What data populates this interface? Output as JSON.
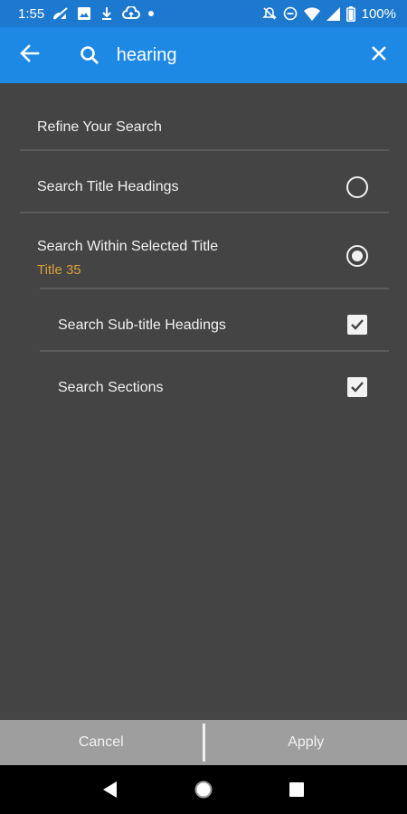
{
  "status": {
    "time": "1:55",
    "battery": "100%",
    "left_icons": [
      "cast-icon",
      "image-icon",
      "download-icon",
      "cloud-upload-icon",
      "dot-icon"
    ],
    "right_icons": [
      "mute-icon",
      "dnd-icon",
      "wifi-icon",
      "signal-icon",
      "battery-icon"
    ]
  },
  "appbar": {
    "search_value": "hearing",
    "back_icon": "arrow-left-icon",
    "search_icon": "search-icon",
    "close_icon": "close-icon"
  },
  "refine": {
    "heading": "Refine Your Search",
    "option_title_headings": {
      "label": "Search Title Headings",
      "selected": false
    },
    "option_within_title": {
      "label": "Search Within Selected Title",
      "sublabel": "Title 35",
      "selected": true
    },
    "sub_options": [
      {
        "label": "Search Sub-title Headings",
        "checked": true
      },
      {
        "label": "Search Sections",
        "checked": true
      }
    ]
  },
  "buttons": {
    "cancel": "Cancel",
    "apply": "Apply"
  },
  "colors": {
    "status_bar": "#1d79cf",
    "app_bar": "#1e88e5",
    "background": "#444444",
    "accent_text": "#d8a13a",
    "bottom_bar": "#9e9e9e"
  }
}
